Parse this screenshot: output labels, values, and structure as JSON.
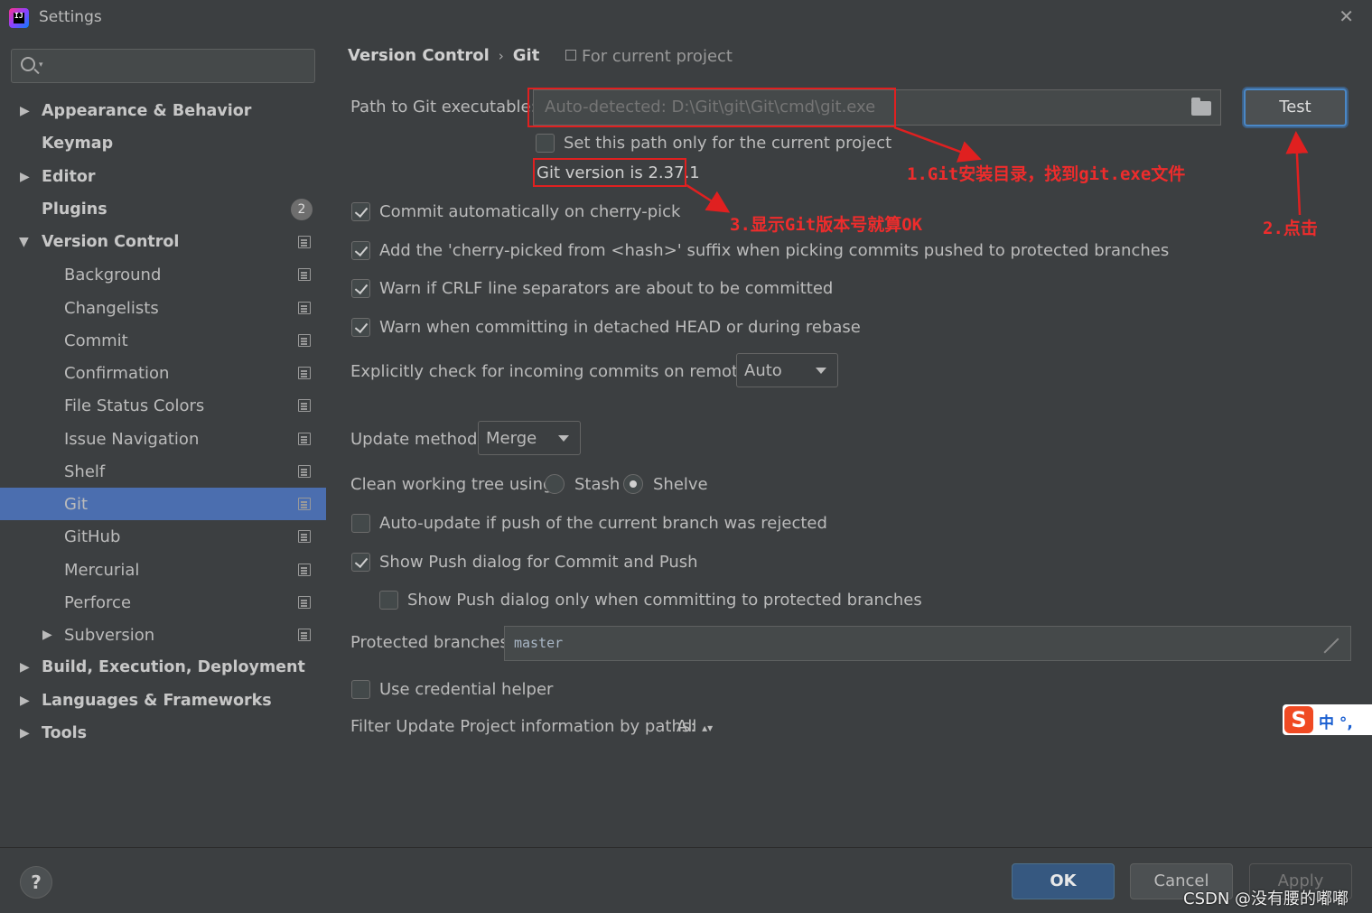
{
  "window": {
    "title": "Settings",
    "close": "✕"
  },
  "search": {
    "placeholder": ""
  },
  "sidebar": {
    "items": [
      {
        "label": "Appearance & Behavior"
      },
      {
        "label": "Keymap"
      },
      {
        "label": "Editor"
      },
      {
        "label": "Plugins",
        "badge": "2"
      },
      {
        "label": "Version Control"
      },
      {
        "label": "Background"
      },
      {
        "label": "Changelists"
      },
      {
        "label": "Commit"
      },
      {
        "label": "Confirmation"
      },
      {
        "label": "File Status Colors"
      },
      {
        "label": "Issue Navigation"
      },
      {
        "label": "Shelf"
      },
      {
        "label": "Git"
      },
      {
        "label": "GitHub"
      },
      {
        "label": "Mercurial"
      },
      {
        "label": "Perforce"
      },
      {
        "label": "Subversion"
      },
      {
        "label": "Build, Execution, Deployment"
      },
      {
        "label": "Languages & Frameworks"
      },
      {
        "label": "Tools"
      }
    ],
    "selected": "Git"
  },
  "breadcrumb": {
    "parent": "Version Control",
    "sep": "›",
    "current": "Git",
    "scope": "For current project"
  },
  "git": {
    "path_label": "Path to Git executable:",
    "path_placeholder": "Auto-detected: D:\\Git\\git\\Git\\cmd\\git.exe",
    "test_label": "Test",
    "set_path_only": "Set this path only for the current project",
    "version_text": "Git version is 2.37.1",
    "opt_cherry_pick": "Commit automatically on cherry-pick",
    "opt_cherry_suffix": "Add the 'cherry-picked from <hash>' suffix when picking commits pushed to protected branches",
    "opt_crlf": "Warn if CRLF line separators are about to be committed",
    "opt_detached": "Warn when committing in detached HEAD or during rebase",
    "incoming_label": "Explicitly check for incoming commits on remotes:",
    "incoming_value": "Auto",
    "update_label": "Update method:",
    "update_value": "Merge",
    "clean_label": "Clean working tree using:",
    "clean_stash": "Stash",
    "clean_shelve": "Shelve",
    "opt_auto_update": "Auto-update if push of the current branch was rejected",
    "opt_show_push": "Show Push dialog for Commit and Push",
    "opt_show_push_protected": "Show Push dialog only when committing to protected branches",
    "protected_label": "Protected branches:",
    "protected_value": "master",
    "opt_credential": "Use credential helper",
    "filter_label": "Filter Update Project information by paths:",
    "filter_value": "All"
  },
  "annotations": {
    "a1": "1.Git安装目录，找到git.exe文件",
    "a2": "2.点击",
    "a3": "3.显示Git版本号就算OK"
  },
  "footer": {
    "help": "?",
    "ok": "OK",
    "cancel": "Cancel",
    "apply": "Apply",
    "watermark": "CSDN @没有腰的嘟嘟"
  },
  "ime": {
    "logo": "S",
    "text": "中 °,"
  }
}
